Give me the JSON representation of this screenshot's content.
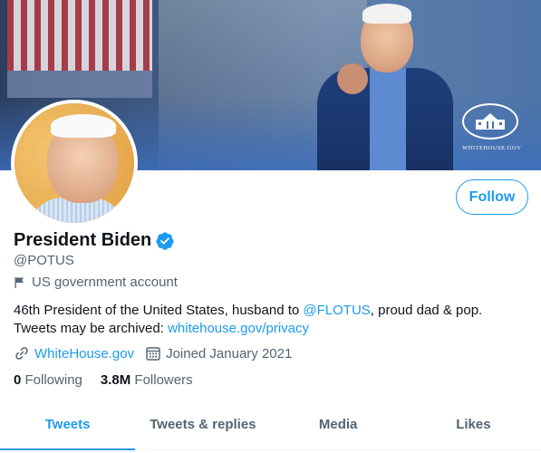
{
  "banner": {
    "logo_label": "WHITEHOUSE.GOV"
  },
  "profile": {
    "follow_label": "Follow",
    "display_name": "President Biden",
    "handle": "@POTUS",
    "account_label": "US government account",
    "bio": {
      "line1_prefix": "46th President of the United States, husband to ",
      "line1_mention": "@FLOTUS",
      "line1_suffix": ", proud dad & pop.",
      "line2_prefix": "Tweets may be archived: ",
      "line2_link": "whitehouse.gov/privacy"
    },
    "website": "WhiteHouse.gov",
    "joined": "Joined January 2021",
    "following_count": "0",
    "following_label": "Following",
    "followers_count": "3.8M",
    "followers_label": "Followers"
  },
  "tabs": [
    {
      "label": "Tweets",
      "active": true
    },
    {
      "label": "Tweets & replies",
      "active": false
    },
    {
      "label": "Media",
      "active": false
    },
    {
      "label": "Likes",
      "active": false
    }
  ],
  "colors": {
    "accent": "#1d9bf0",
    "text_primary": "#0f1419",
    "text_secondary": "#536471"
  },
  "icons": {
    "verified": "verified-badge-icon",
    "government": "flag-icon",
    "website": "link-icon",
    "joined": "calendar-icon"
  }
}
